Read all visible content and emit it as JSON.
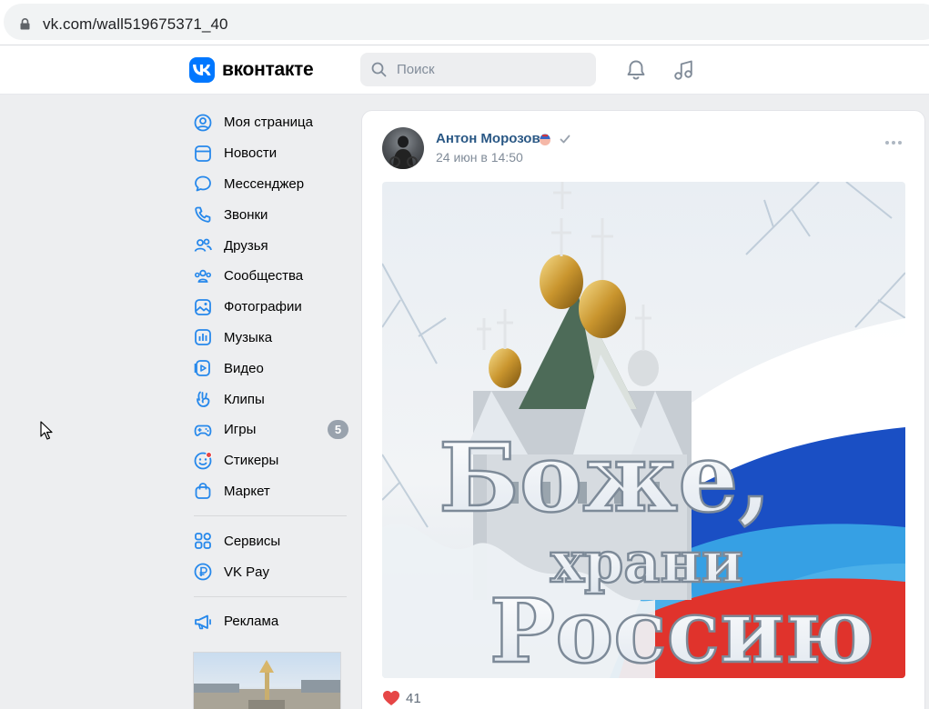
{
  "browser": {
    "url": "vk.com/wall519675371_40"
  },
  "header": {
    "logo_text": "вконтакте",
    "search_placeholder": "Поиск"
  },
  "menu": {
    "items": [
      {
        "label": "Моя страница",
        "icon": "user-circle-icon"
      },
      {
        "label": "Новости",
        "icon": "news-icon"
      },
      {
        "label": "Мессенджер",
        "icon": "message-icon"
      },
      {
        "label": "Звонки",
        "icon": "phone-icon"
      },
      {
        "label": "Друзья",
        "icon": "friends-icon"
      },
      {
        "label": "Сообщества",
        "icon": "communities-icon"
      },
      {
        "label": "Фотографии",
        "icon": "photo-icon"
      },
      {
        "label": "Музыка",
        "icon": "music-icon"
      },
      {
        "label": "Видео",
        "icon": "video-icon"
      },
      {
        "label": "Клипы",
        "icon": "clips-icon"
      },
      {
        "label": "Игры",
        "icon": "games-icon",
        "badge": "5"
      },
      {
        "label": "Стикеры",
        "icon": "stickers-icon"
      },
      {
        "label": "Маркет",
        "icon": "market-icon"
      }
    ],
    "items2": [
      {
        "label": "Сервисы",
        "icon": "services-icon"
      },
      {
        "label": "VK Pay",
        "icon": "vkpay-icon"
      }
    ],
    "items3": [
      {
        "label": "Реклама",
        "icon": "ads-icon"
      }
    ]
  },
  "post": {
    "author": "Антон Морозов",
    "date": "24 июн в 14:50",
    "image_text": {
      "line1": "Боже,",
      "line2": "храни",
      "line3": "Россию"
    },
    "likes": "41"
  },
  "colors": {
    "accent": "#0077ff",
    "link": "#2a5885",
    "like": "#e64646",
    "bg": "#edeef0"
  }
}
